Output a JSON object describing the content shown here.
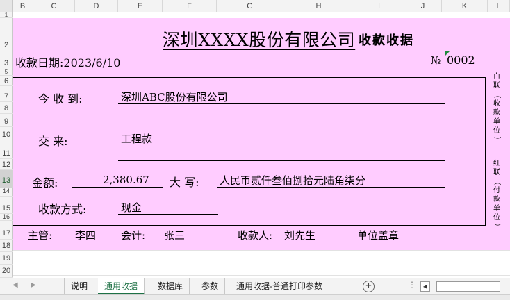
{
  "columns": [
    "B",
    "C",
    "D",
    "E",
    "F",
    "G",
    "H",
    "I",
    "J",
    "K",
    "L"
  ],
  "rows": [
    "1",
    "2",
    "3",
    "5",
    "6",
    "7",
    "8",
    "9",
    "10",
    "11",
    "12",
    "13",
    "14",
    "15",
    "16",
    "17",
    "18",
    "19",
    "20"
  ],
  "selected_row": "13",
  "receipt": {
    "title": "深圳XXXX股份有限公司",
    "subtitle": "收款收据",
    "date_label": "收款日期:",
    "date_value": "2023/6/10",
    "no_symbol": "№",
    "no_value": "0002",
    "received_from_label": "今 收 到:",
    "received_from_value": "深圳ABC股份有限公司",
    "for_label": "交    来:",
    "for_value": "工程款",
    "amount_label": "金额:",
    "amount_value": "2,380.67",
    "caps_label": "大 写:",
    "caps_value": "人民币贰仟叁佰捌拾元陆角柒分",
    "method_label": "收款方式:",
    "method_value": "现金",
    "side_top": "白联（收款单位）",
    "side_bottom": "红联（付款单位）",
    "supervisor_label": "主管:",
    "supervisor_value": "李四",
    "accountant_label": "会计:",
    "accountant_value": "张三",
    "payee_label": "收款人:",
    "payee_value": "刘先生",
    "seal_label": "单位盖章"
  },
  "tabs": [
    "说明",
    "通用收据",
    "数据库",
    "参数",
    "通用收据-普通打印参数"
  ],
  "active_tab": "通用收据",
  "add_sheet": "+"
}
